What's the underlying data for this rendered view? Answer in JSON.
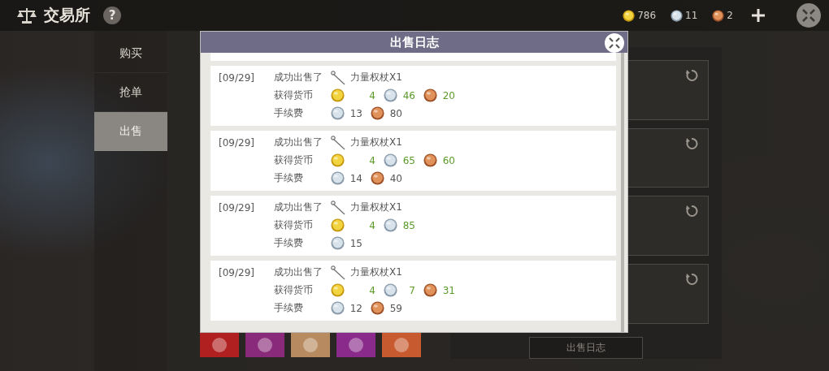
{
  "header": {
    "title": "交易所",
    "help": "?",
    "currencies": [
      {
        "kind": "gold",
        "amount": "786"
      },
      {
        "kind": "silver",
        "amount": "11"
      },
      {
        "kind": "copper",
        "amount": "2"
      }
    ]
  },
  "tabs": [
    {
      "label": "购买",
      "selected": false
    },
    {
      "label": "抢单",
      "selected": false
    },
    {
      "label": "出售",
      "selected": true
    }
  ],
  "sell_panel": {
    "log_button": "出售日志"
  },
  "dialog": {
    "title": "出售日志",
    "entries": [
      {
        "date": "[09/29]",
        "action": "成功出售了",
        "item": "力量权杖X1",
        "income_label": "获得货币",
        "income": [
          {
            "kind": "gold",
            "amount": "4"
          },
          {
            "kind": "silver",
            "amount": "46"
          },
          {
            "kind": "copper",
            "amount": "20"
          }
        ],
        "fee_label": "手续费",
        "fee": [
          {
            "kind": "silver",
            "amount": "13"
          },
          {
            "kind": "copper",
            "amount": "80"
          }
        ]
      },
      {
        "date": "[09/29]",
        "action": "成功出售了",
        "item": "力量权杖X1",
        "income_label": "获得货币",
        "income": [
          {
            "kind": "gold",
            "amount": "4"
          },
          {
            "kind": "silver",
            "amount": "65"
          },
          {
            "kind": "copper",
            "amount": "60"
          }
        ],
        "fee_label": "手续费",
        "fee": [
          {
            "kind": "silver",
            "amount": "14"
          },
          {
            "kind": "copper",
            "amount": "40"
          }
        ]
      },
      {
        "date": "[09/29]",
        "action": "成功出售了",
        "item": "力量权杖X1",
        "income_label": "获得货币",
        "income": [
          {
            "kind": "gold",
            "amount": "4"
          },
          {
            "kind": "silver",
            "amount": "85"
          }
        ],
        "fee_label": "手续费",
        "fee": [
          {
            "kind": "silver",
            "amount": "15"
          }
        ]
      },
      {
        "date": "[09/29]",
        "action": "成功出售了",
        "item": "力量权杖X1",
        "income_label": "获得货币",
        "income": [
          {
            "kind": "gold",
            "amount": "4"
          },
          {
            "kind": "silver",
            "amount": "7"
          },
          {
            "kind": "copper",
            "amount": "31"
          }
        ],
        "fee_label": "手续费",
        "fee": [
          {
            "kind": "silver",
            "amount": "12"
          },
          {
            "kind": "copper",
            "amount": "59"
          }
        ]
      }
    ]
  }
}
